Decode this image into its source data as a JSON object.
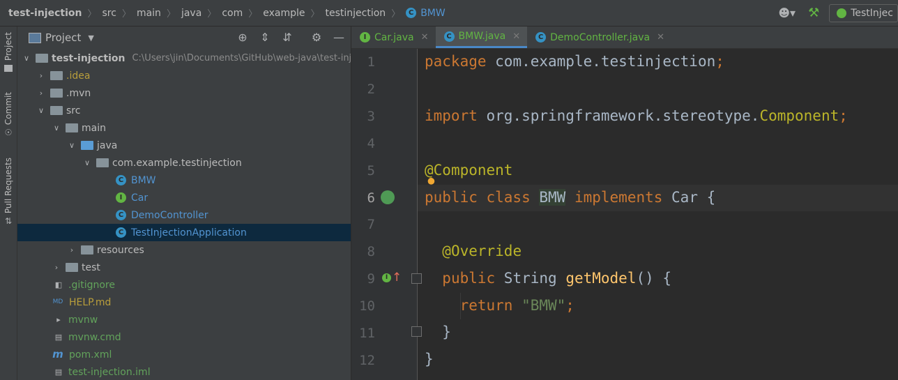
{
  "breadcrumbs": [
    "test-injection",
    "src",
    "main",
    "java",
    "com",
    "example",
    "testinjection",
    "BMW"
  ],
  "run_config": "TestInjec",
  "side_tabs": {
    "project": "Project",
    "commit": "Commit",
    "pull_requests": "Pull Requests"
  },
  "project_panel": {
    "title": "Project",
    "tree": [
      {
        "label": "test-injection",
        "extra": "C:\\Users\\jin\\Documents\\GitHub\\web-java\\test-inj"
      },
      {
        "label": ".idea"
      },
      {
        "label": ".mvn"
      },
      {
        "label": "src"
      },
      {
        "label": "main"
      },
      {
        "label": "java"
      },
      {
        "label": "com.example.testinjection"
      },
      {
        "label": "BMW"
      },
      {
        "label": "Car"
      },
      {
        "label": "DemoController"
      },
      {
        "label": "TestInjectionApplication"
      },
      {
        "label": "resources"
      },
      {
        "label": "test"
      },
      {
        "label": ".gitignore"
      },
      {
        "label": "HELP.md"
      },
      {
        "label": "mvnw"
      },
      {
        "label": "mvnw.cmd"
      },
      {
        "label": "pom.xml"
      },
      {
        "label": "test-injection.iml"
      }
    ]
  },
  "editor_tabs": [
    {
      "label": "Car.java",
      "icon": "I"
    },
    {
      "label": "BMW.java",
      "icon": "C"
    },
    {
      "label": "DemoController.java",
      "icon": "C"
    }
  ],
  "line_numbers": [
    "1",
    "2",
    "3",
    "4",
    "5",
    "6",
    "7",
    "8",
    "9",
    "10",
    "11",
    "12"
  ],
  "code": {
    "l1": {
      "kw": "package",
      "rest": " com.example.testinjection",
      "semi": ";"
    },
    "l3": {
      "kw": "import",
      "rest": " org.springframework.stereotype.",
      "cls": "Component",
      "semi": ";"
    },
    "l5": {
      "at": "@",
      "ann": "Component"
    },
    "l6": {
      "kw1": "public",
      "kw2": " class ",
      "name": "BMW",
      "kw3": " implements",
      "rest": " Car {"
    },
    "l8": {
      "ann": "@Override"
    },
    "l9": {
      "kw": "public",
      "type": " String ",
      "fn": "getModel",
      "rest": "() {"
    },
    "l10": {
      "kw": "return",
      "str": " \"BMW\"",
      "semi": ";"
    },
    "l11": {
      "brace": "}"
    },
    "l12": {
      "brace": "}"
    }
  }
}
